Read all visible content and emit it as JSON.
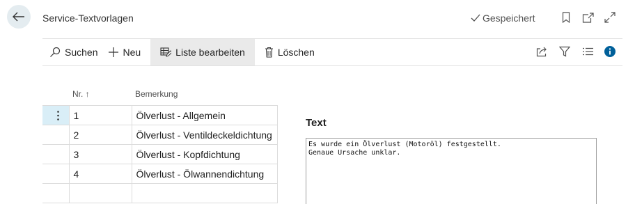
{
  "header": {
    "title": "Service-Textvorlagen",
    "saved_status": "Gespeichert",
    "icons": [
      "back-arrow-icon",
      "checkmark-icon",
      "bookmark-icon",
      "open-new-window-icon",
      "expand-icon"
    ]
  },
  "toolbar": {
    "search_label": "Suchen",
    "new_label": "Neu",
    "edit_list_label": "Liste bearbeiten",
    "delete_label": "Löschen",
    "right_icons": [
      "share-icon",
      "filter-icon",
      "list-view-icon",
      "info-icon"
    ]
  },
  "grid": {
    "columns": {
      "nr": "Nr. ↑",
      "remark": "Bemerkung"
    },
    "rows": [
      {
        "nr": "1",
        "remark": "Ölverlust - Allgemein"
      },
      {
        "nr": "2",
        "remark": "Ölverlust - Ventildeckeldichtung"
      },
      {
        "nr": "3",
        "remark": "Ölverlust - Kopfdichtung"
      },
      {
        "nr": "4",
        "remark": "Ölverlust - Ölwannendichtung"
      },
      {
        "nr": "",
        "remark": ""
      }
    ]
  },
  "text_panel": {
    "label": "Text",
    "value": "Es wurde ein Ölverlust (Motoröl) festgestellt.\nGenaue Ursache unklar."
  },
  "colors": {
    "accent": "#00609a",
    "selected_row": "#d9eef7",
    "active_button": "#eaeaea"
  }
}
